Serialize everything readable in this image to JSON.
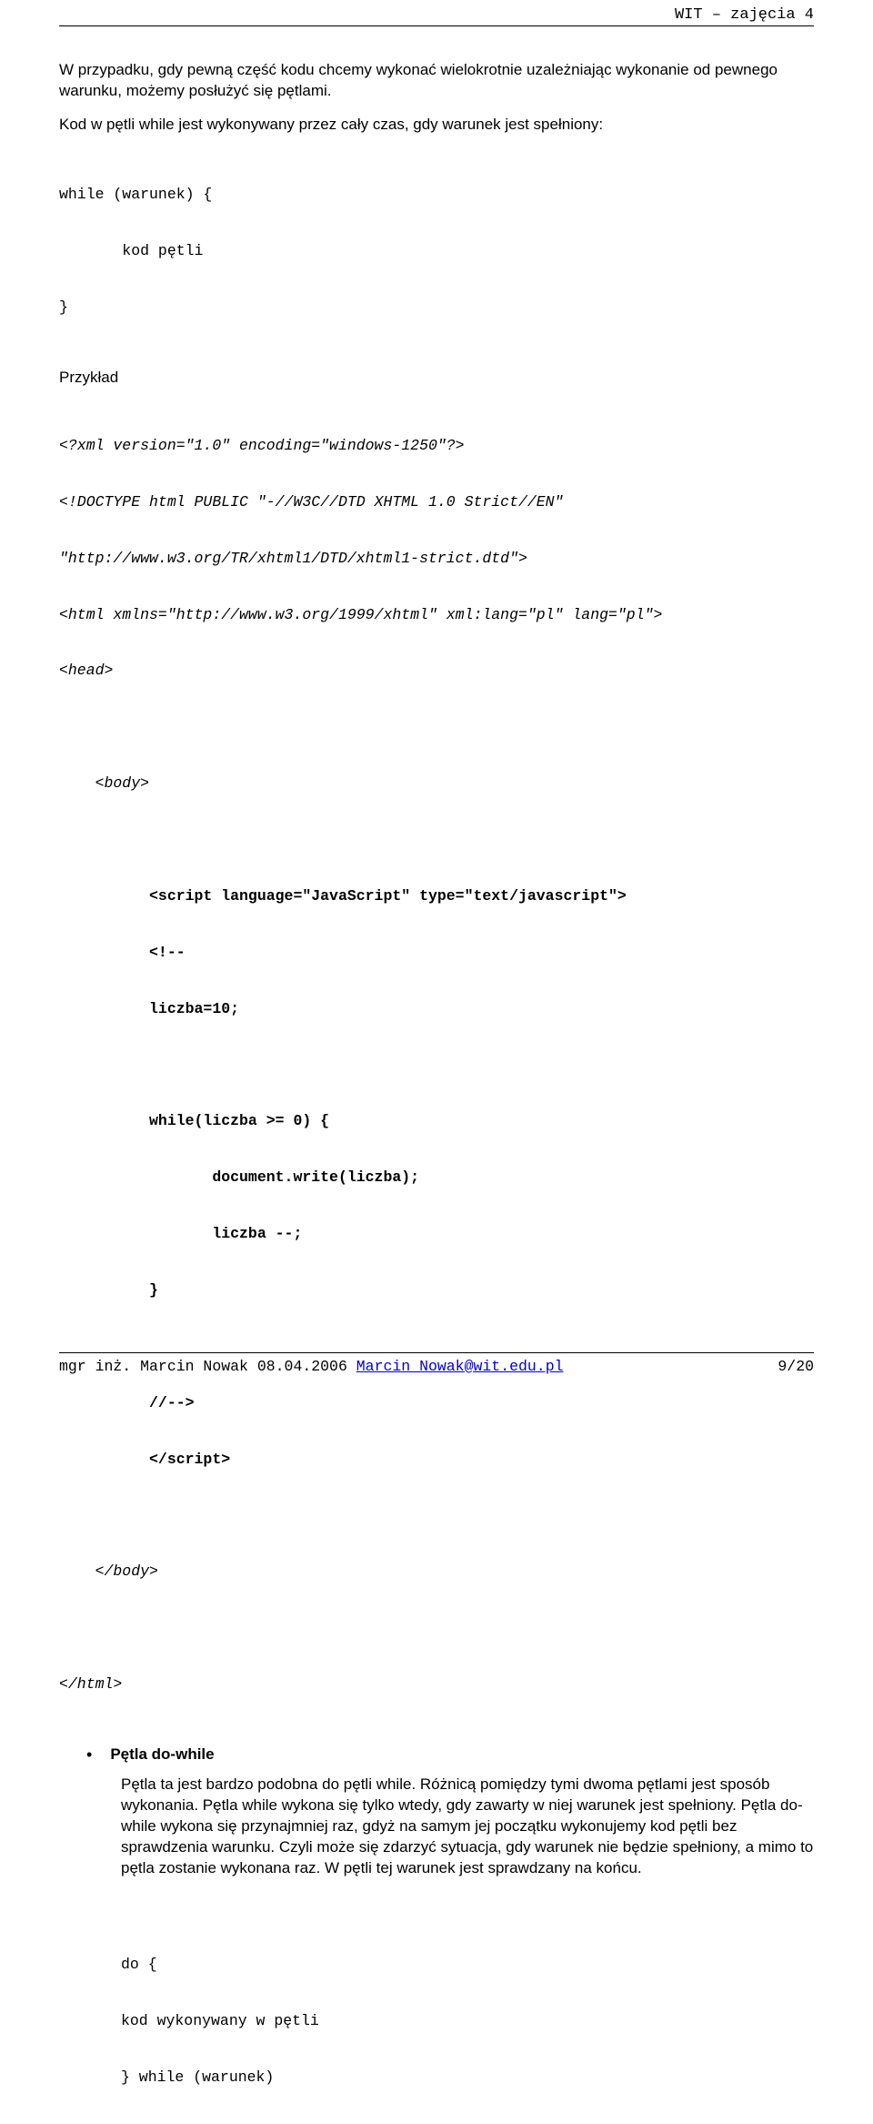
{
  "header": {
    "title": "WIT – zajęcia 4"
  },
  "intro": {
    "p1": "W przypadku, gdy pewną część kodu chcemy wykonać wielokrotnie uzależniając wykonanie od pewnego warunku, możemy posłużyć się pętlami.",
    "p2": "Kod w pętli while jest wykonywany przez cały czas, gdy warunek jest spełniony:"
  },
  "code1": {
    "l1": "while (warunek) {",
    "l2": "       kod pętli",
    "l3": "}"
  },
  "example_label": "Przykład",
  "code2": {
    "l1": "<?xml version=\"1.0\" encoding=\"windows-1250\"?>",
    "l2": "<!DOCTYPE html PUBLIC \"-//W3C//DTD XHTML 1.0 Strict//EN\"",
    "l3": "\"http://www.w3.org/TR/xhtml1/DTD/xhtml1-strict.dtd\">",
    "l4": "<html xmlns=\"http://www.w3.org/1999/xhtml\" xml:lang=\"pl\" lang=\"pl\">",
    "l5": "<head>",
    "l6": "    <body>",
    "l7": "          <script language=\"JavaScript\" type=\"text/javascript\">",
    "l8": "          <!--",
    "l9": "          liczba=10;",
    "l10": "          while(liczba >= 0) {",
    "l11": "                 document.write(liczba);",
    "l12": "                 liczba --;",
    "l13": "          }",
    "l14": "          //-->",
    "l15": "          </script>",
    "l16": "    </body>",
    "l17": "</html>"
  },
  "dowhile": {
    "heading": "Pętla do-while",
    "para": "Pętla ta jest bardzo podobna do pętli while. Różnicą pomiędzy tymi dwoma pętlami jest sposób wykonania. Pętla while wykona się tylko wtedy, gdy zawarty w niej warunek jest spełniony. Pętla do-while wykona się przynajmniej raz, gdyż na samym jej początku wykonujemy kod pętli bez sprawdzenia warunku. Czyli może się zdarzyć sytuacja, gdy warunek nie będzie spełniony, a mimo to pętla zostanie wykonana raz. W pętli tej warunek jest sprawdzany na końcu."
  },
  "code3": {
    "l1": "do {",
    "l2": "kod wykonywany w pętli",
    "l3": "} while (warunek)"
  },
  "footer": {
    "left_prefix": "mgr inż. Marcin Nowak 08.04.2006 ",
    "email": "Marcin_Nowak@wit.edu.pl",
    "page": "9/20"
  }
}
